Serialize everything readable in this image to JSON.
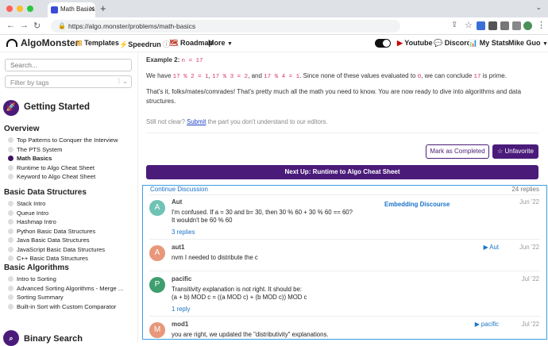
{
  "browser": {
    "tab_title": "Math Basics - Getting Started",
    "url": "https://algo.monster/problems/math-basics"
  },
  "header": {
    "logo": "AlgoMonster",
    "templates": "Templates",
    "speedrun": "Speedrun",
    "roadmap": "Roadmap",
    "more": "More",
    "youtube": "Youtube",
    "discord": "Discord",
    "my_stats": "My Stats",
    "user": "Mike Guo"
  },
  "sidebar": {
    "search_placeholder": "Search...",
    "filter_placeholder": "Filter by tags",
    "section_title": "Getting Started",
    "groups": [
      {
        "title": "Overview",
        "items": [
          "Top Patterns to Conquer the Interview",
          "The PTS System",
          "Math Basics",
          "Runtime to Algo Cheat Sheet",
          "Keyword to Algo Cheat Sheet"
        ]
      },
      {
        "title": "Basic Data Structures",
        "items": [
          "Stack Intro",
          "Queue Intro",
          "Hashmap Intro",
          "Python Basic Data Structures",
          "Java Basic Data Structures",
          "JavaScript Basic Data Structures",
          "C++ Basic Data Structures"
        ]
      },
      {
        "title": "Basic Algorithms",
        "items": [
          "Intro to Sorting",
          "Advanced Sorting Algorithms - Merge ...",
          "Sorting Summary",
          "Built-in Sort with Custom Comparator"
        ]
      }
    ],
    "next_section": "Binary Search"
  },
  "main": {
    "example_label": "Example 2:",
    "example_code": "n = 17",
    "p1_a": "We have ",
    "p1_c1": "17 % 2 = 1",
    "p1_b": ", ",
    "p1_c2": "17 % 3 = 2",
    "p1_d": ", and ",
    "p1_c3": "17 % 4 = 1",
    "p1_e": ". Since none of these values evaluated to ",
    "p1_c4": "0",
    "p1_f": ", we can conclude ",
    "p1_c5": "17",
    "p1_g": " is prime.",
    "p2_line1": "That's it, folks/mates/comrades! That's pretty much all the math you need to know. You are now ready to dive into algorithms and data",
    "p2_line2": "structures.",
    "unclear_a": "Still not clear? ",
    "unclear_link": "Submit",
    "unclear_b": " the part you don't understand to our editors.",
    "mark_completed": "Mark as Completed",
    "unfavorite": "Unfavorite",
    "next_up": "Next Up: Runtime to Algo Cheat Sheet"
  },
  "discourse": {
    "continue": "Continue Discussion",
    "replies_count": "24 replies",
    "embedding": "Embedding Discourse",
    "posts": [
      {
        "avatar": "A",
        "color": "#6fc3b5",
        "name": "Aut",
        "lines": [
          "I'm confused. If a = 30 and b= 30, then 30 % 60 + 30 % 60 == 60?",
          "It wouldn't be 60 % 60"
        ],
        "date": "Jun '22",
        "replies": "3 replies",
        "reply_to": ""
      },
      {
        "avatar": "A",
        "color": "#e8977a",
        "name": "aut1",
        "lines": [
          "nvm I needed to distribute the c"
        ],
        "date": "Jun '22",
        "replies": "",
        "reply_to": "Aut"
      },
      {
        "avatar": "P",
        "color": "#3e9e6e",
        "name": "pacific",
        "lines": [
          "Transitivity explanation is not right. It should be:",
          "(a + b) MOD c = ((a MOD c) + (b MOD c)) MOD c"
        ],
        "date": "Jul '22",
        "replies": "1 reply",
        "reply_to": ""
      },
      {
        "avatar": "M",
        "color": "#e8977a",
        "name": "mod1",
        "lines": [
          "you are right, we updated the \"distributivity\" explanations."
        ],
        "date": "Jul '22",
        "replies": "",
        "reply_to": "pacific"
      }
    ]
  }
}
